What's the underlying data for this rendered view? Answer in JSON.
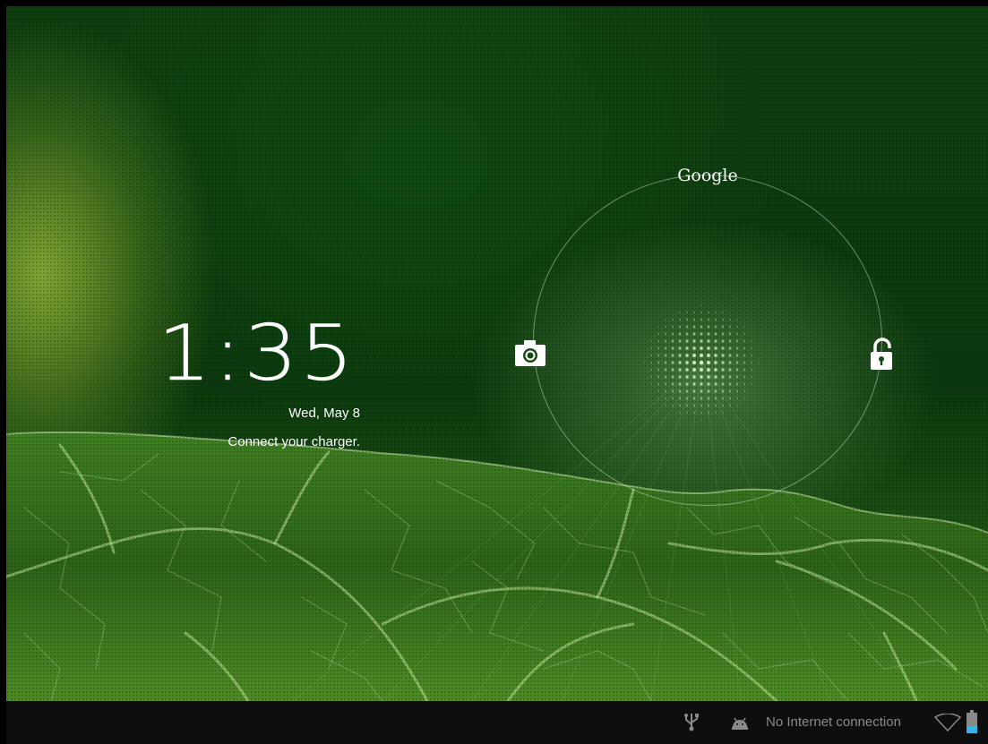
{
  "lock_screen": {
    "time": "1:35",
    "date": "Wed, May 8",
    "status_message": "Connect your charger.",
    "google_label": "Google",
    "targets": {
      "left": "camera-icon",
      "right": "unlock-icon",
      "top": "Google",
      "center": "lock-handle"
    }
  },
  "status_bar": {
    "icons": [
      "usb-icon",
      "android-icon",
      "wifi-icon",
      "battery-icon"
    ],
    "network_text": "No Internet connection"
  },
  "colors": {
    "wallpaper_dark": "#0c3a0e",
    "wallpaper_light": "#5a9a2a",
    "status_bar_bg": "#0e0e0e",
    "status_text": "#8a8a8a",
    "battery_accent": "#33b5e5"
  }
}
